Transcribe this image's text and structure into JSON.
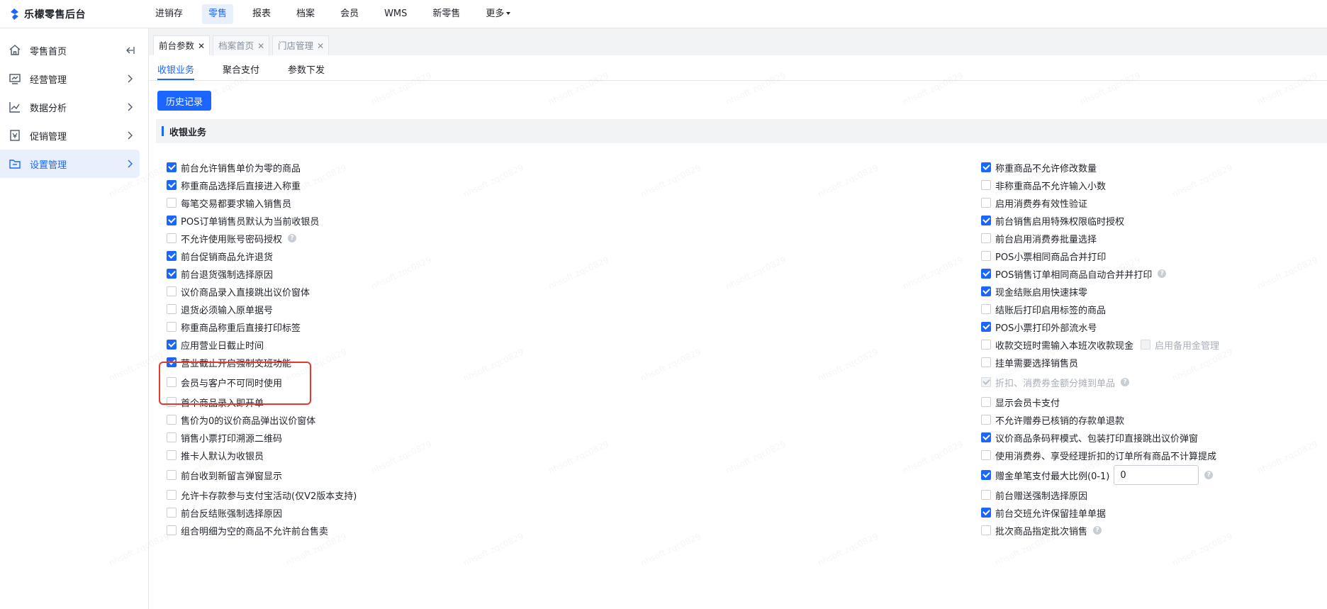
{
  "app": {
    "brand": "乐檬零售后台",
    "brand_color": "#1a66ff"
  },
  "topnav": {
    "items": [
      "进销存",
      "零售",
      "报表",
      "档案",
      "会员",
      "WMS",
      "新零售",
      "更多"
    ],
    "active": "零售"
  },
  "sidebar": {
    "items": [
      {
        "label": "零售首页",
        "icon": "home-icon"
      },
      {
        "label": "经营管理",
        "icon": "monitor-icon"
      },
      {
        "label": "数据分析",
        "icon": "line-chart-icon"
      },
      {
        "label": "促销管理",
        "icon": "coupon-icon"
      },
      {
        "label": "设置管理",
        "icon": "folder-icon"
      }
    ],
    "active": "设置管理",
    "collapse_icon": "collapse-left-icon"
  },
  "page_tabs": [
    {
      "label": "前台参数",
      "active": true
    },
    {
      "label": "档案首页",
      "active": false
    },
    {
      "label": "门店管理",
      "active": false
    }
  ],
  "sub_tabs": {
    "items": [
      "收银业务",
      "聚合支付",
      "参数下发"
    ],
    "active": "收银业务"
  },
  "history_button": "历史记录",
  "section_title": "收银业务",
  "left_options": [
    {
      "label": "前台允许销售单价为零的商品",
      "checked": true
    },
    {
      "label": "称重商品选择后直接进入称重",
      "checked": true
    },
    {
      "label": "每笔交易都要求输入销售员",
      "checked": false
    },
    {
      "label": "POS订单销售员默认为当前收银员",
      "checked": true
    },
    {
      "label": "不允许使用账号密码授权",
      "checked": false,
      "help": true
    },
    {
      "label": "前台促销商品允许退货",
      "checked": true
    },
    {
      "label": "前台退货强制选择原因",
      "checked": true
    },
    {
      "label": "议价商品录入直接跳出议价窗体",
      "checked": false
    },
    {
      "label": "退货必须输入原单据号",
      "checked": false
    },
    {
      "label": "称重商品称重后直接打印标签",
      "checked": false
    },
    {
      "label": "应用营业日截止时间",
      "checked": true
    },
    {
      "label": "营业截止开启强制交班功能",
      "checked": true
    },
    {
      "label": "会员与客户不可同时使用",
      "checked": false
    },
    {
      "label": "首个商品录入即开单",
      "checked": false
    },
    {
      "label": "售价为0的议价商品弹出议价窗体",
      "checked": false
    },
    {
      "label": "销售小票打印溯源二维码",
      "checked": false
    },
    {
      "label": "推卡人默认为收银员",
      "checked": false
    },
    {
      "label": "前台收到新留言弹窗显示",
      "checked": false
    },
    {
      "label": "允许卡存款参与支付宝活动(仅V2版本支持)",
      "checked": false
    },
    {
      "label": "前台反结账强制选择原因",
      "checked": false
    },
    {
      "label": "组合明细为空的商品不允许前台售卖",
      "checked": false
    }
  ],
  "right_options": [
    {
      "label": "称重商品不允许修改数量",
      "checked": true
    },
    {
      "label": "非称重商品不允许输入小数",
      "checked": false
    },
    {
      "label": "启用消费券有效性验证",
      "checked": false
    },
    {
      "label": "前台销售启用特殊权限临时授权",
      "checked": true
    },
    {
      "label": "前台启用消费券批量选择",
      "checked": false
    },
    {
      "label": "POS小票相同商品合并打印",
      "checked": false
    },
    {
      "label": "POS销售订单相同商品自动合并并打印",
      "checked": true,
      "help": true
    },
    {
      "label": "现金结账启用快速抹零",
      "checked": true
    },
    {
      "label": "结账后打印启用标签的商品",
      "checked": false
    },
    {
      "label": "POS小票打印外部流水号",
      "checked": true
    },
    {
      "label": "收款交班时需输入本班次收款现金",
      "checked": false,
      "sub": {
        "label": "启用备用金管理",
        "checked": false
      }
    },
    {
      "label": "挂单需要选择销售员",
      "checked": false
    },
    {
      "label": "折扣、消费券金额分摊到单品",
      "checked": true,
      "disabled": true,
      "help": true
    },
    {
      "label": "显示会员卡支付",
      "checked": false
    },
    {
      "label": "不允许赠券已核销的存款单退款",
      "checked": false
    },
    {
      "label": "议价商品条码秤模式、包装打印直接跳出议价弹窗",
      "checked": true
    },
    {
      "label": "使用消费券、享受经理折扣的订单所有商品不计算提成",
      "checked": false
    },
    {
      "label": "赠金单笔支付最大比例(0-1)",
      "checked": true,
      "input_value": "0",
      "help": true
    },
    {
      "label": "前台赠送强制选择原因",
      "checked": false
    },
    {
      "label": "前台交班允许保留挂单单据",
      "checked": true
    },
    {
      "label": "批次商品指定批次销售",
      "checked": false,
      "help": true
    }
  ],
  "watermark": "nhsoft.zqc0829",
  "help_glyph": "?"
}
